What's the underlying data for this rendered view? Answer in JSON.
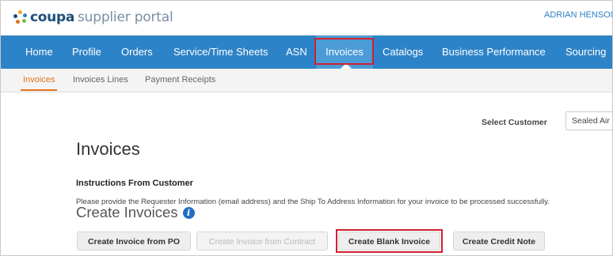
{
  "header": {
    "brand_bold": "coupa",
    "brand_rest": "supplier portal",
    "user_name": "ADRIAN HENSON",
    "logo_colors": [
      "#f5a623",
      "#2d83c7",
      "#7cbb42",
      "#e0721e",
      "#1e4e79"
    ]
  },
  "nav": {
    "items": [
      {
        "label": "Home"
      },
      {
        "label": "Profile"
      },
      {
        "label": "Orders"
      },
      {
        "label": "Service/Time Sheets"
      },
      {
        "label": "ASN"
      },
      {
        "label": "Invoices",
        "active": true
      },
      {
        "label": "Catalogs"
      },
      {
        "label": "Business Performance"
      },
      {
        "label": "Sourcing"
      }
    ],
    "highlighted": "Invoices"
  },
  "subtabs": {
    "items": [
      {
        "label": "Invoices",
        "active": true
      },
      {
        "label": "Invoices Lines"
      },
      {
        "label": "Payment Receipts"
      }
    ]
  },
  "customer": {
    "label": "Select Customer",
    "value": "Sealed Air"
  },
  "main": {
    "title": "Invoices",
    "instructions_heading": "Instructions From Customer",
    "instructions_text": "Please provide the Requester Information (email address) and the Ship To Address Information for your invoice to be processed successfully.",
    "create_heading": "Create Invoices",
    "info_icon": "i"
  },
  "actions": {
    "from_po": "Create Invoice from PO",
    "from_contract": "Create Invoice from Contract",
    "blank": "Create Blank Invoice",
    "credit_note": "Create Credit Note",
    "highlighted": "Create Blank Invoice"
  },
  "colors": {
    "nav_bg": "#2d83c7",
    "nav_active": "#4b9bd6",
    "highlight": "#d0202f",
    "subtab_active": "#e0721e",
    "link": "#2d7fc4"
  }
}
